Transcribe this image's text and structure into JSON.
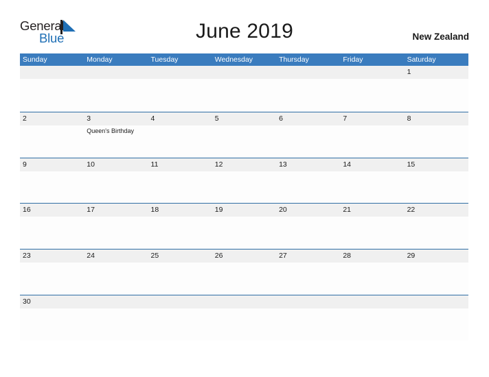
{
  "logo": {
    "word_one": "General",
    "word_two": "Blue",
    "flag_icon": "triangle-flag-icon",
    "color_dark": "#231f20",
    "color_blue": "#1f6fb5"
  },
  "header": {
    "title": "June 2019",
    "region": "New Zealand"
  },
  "theme": {
    "header_blue": "#3a7cbe",
    "rule_blue": "#2e6da4",
    "band_gray": "#f0f0f0",
    "cell_white": "#fdfdfd",
    "text_dark": "#1a1a1a"
  },
  "weekdays": [
    "Sunday",
    "Monday",
    "Tuesday",
    "Wednesday",
    "Thursday",
    "Friday",
    "Saturday"
  ],
  "weeks": [
    [
      {
        "day": ""
      },
      {
        "day": ""
      },
      {
        "day": ""
      },
      {
        "day": ""
      },
      {
        "day": ""
      },
      {
        "day": ""
      },
      {
        "day": "1"
      }
    ],
    [
      {
        "day": "2"
      },
      {
        "day": "3",
        "event": "Queen's Birthday"
      },
      {
        "day": "4"
      },
      {
        "day": "5"
      },
      {
        "day": "6"
      },
      {
        "day": "7"
      },
      {
        "day": "8"
      }
    ],
    [
      {
        "day": "9"
      },
      {
        "day": "10"
      },
      {
        "day": "11"
      },
      {
        "day": "12"
      },
      {
        "day": "13"
      },
      {
        "day": "14"
      },
      {
        "day": "15"
      }
    ],
    [
      {
        "day": "16"
      },
      {
        "day": "17"
      },
      {
        "day": "18"
      },
      {
        "day": "19"
      },
      {
        "day": "20"
      },
      {
        "day": "21"
      },
      {
        "day": "22"
      }
    ],
    [
      {
        "day": "23"
      },
      {
        "day": "24"
      },
      {
        "day": "25"
      },
      {
        "day": "26"
      },
      {
        "day": "27"
      },
      {
        "day": "28"
      },
      {
        "day": "29"
      }
    ],
    [
      {
        "day": "30"
      },
      {
        "day": ""
      },
      {
        "day": ""
      },
      {
        "day": ""
      },
      {
        "day": ""
      },
      {
        "day": ""
      },
      {
        "day": ""
      }
    ]
  ]
}
